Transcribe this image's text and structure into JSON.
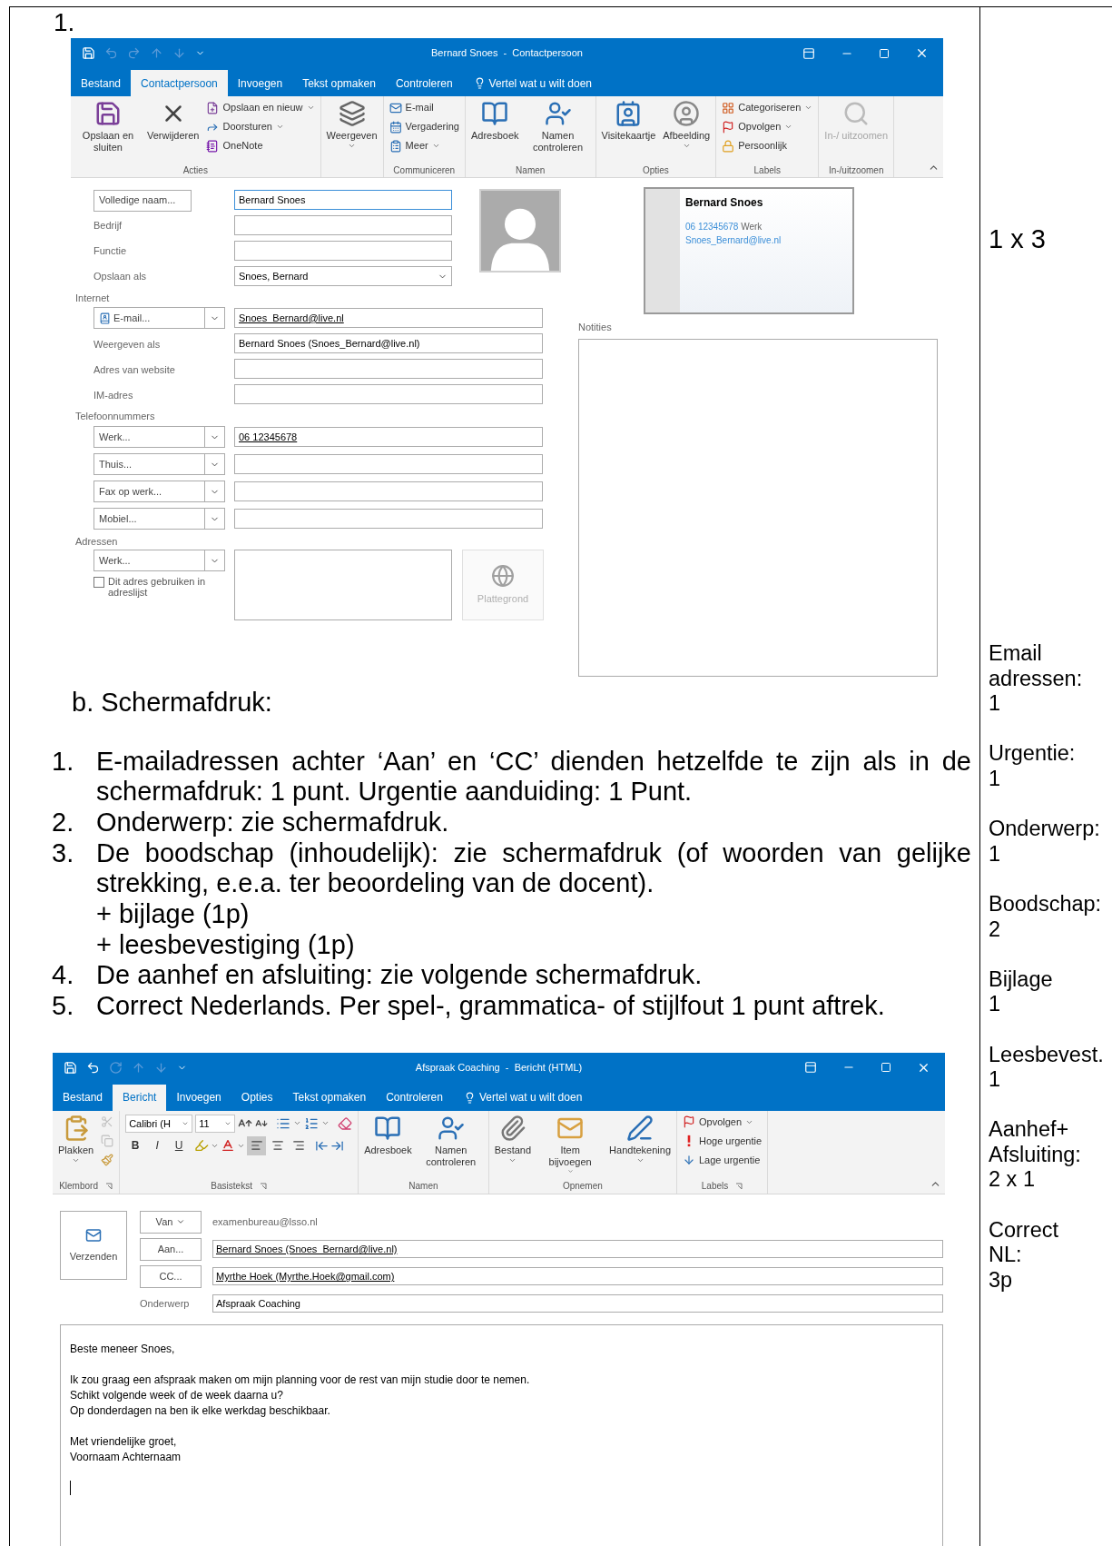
{
  "question_number": "1.",
  "contact_window": {
    "title": "Bernard Snoes  -  Contactpersoon",
    "quick_access": [
      {
        "disabled": false
      },
      {
        "disabled": true
      },
      {
        "disabled": true
      },
      {
        "disabled": true
      },
      {
        "disabled": true
      },
      {
        "disabled": false
      }
    ],
    "tabs": [
      {
        "label": "Bestand",
        "selected": false
      },
      {
        "label": "Contactpersoon",
        "selected": true
      },
      {
        "label": "Invoegen",
        "selected": false
      },
      {
        "label": "Tekst opmaken",
        "selected": false
      },
      {
        "label": "Controleren",
        "selected": false
      }
    ],
    "tell_me": "Vertel wat u wilt doen",
    "ribbon": [
      {
        "label": "Acties",
        "launcher": false,
        "kind": "buttons",
        "items": [
          {
            "kind": "large",
            "label": "Opslaan en sluiten",
            "dropdown": false,
            "disabled": false
          },
          {
            "kind": "large",
            "label": "Verwijderen",
            "dropdown": false,
            "disabled": false
          },
          {
            "kind": "small",
            "label": "Opslaan en nieuw",
            "dropdown": true,
            "disabled": false
          },
          {
            "kind": "small",
            "label": "Doorsturen",
            "dropdown": true,
            "disabled": false
          },
          {
            "kind": "small",
            "label": "OneNote",
            "dropdown": false,
            "disabled": false
          }
        ]
      },
      {
        "launcher": false,
        "kind": "buttons",
        "items": [
          {
            "kind": "large",
            "label": "Weergeven",
            "dropdown": true,
            "disabled": false
          }
        ]
      },
      {
        "label": "Communiceren",
        "launcher": false,
        "kind": "buttons",
        "items": [
          {
            "kind": "small",
            "label": "E-mail",
            "dropdown": false,
            "disabled": false
          },
          {
            "kind": "small",
            "label": "Vergadering",
            "dropdown": false,
            "disabled": false
          },
          {
            "kind": "small",
            "label": "Meer",
            "dropdown": true,
            "disabled": false
          }
        ]
      },
      {
        "label": "Namen",
        "launcher": false,
        "kind": "buttons",
        "items": [
          {
            "kind": "large",
            "label": "Adresboek",
            "dropdown": false,
            "disabled": false
          },
          {
            "kind": "large",
            "label": "Namen controleren",
            "dropdown": false,
            "disabled": false
          }
        ]
      },
      {
        "label": "Opties",
        "launcher": false,
        "kind": "buttons",
        "items": [
          {
            "kind": "large",
            "label": "Visitekaartje",
            "dropdown": false,
            "disabled": false
          },
          {
            "kind": "large",
            "label": "Afbeelding",
            "dropdown": true,
            "disabled": false
          }
        ]
      },
      {
        "label": "Labels",
        "launcher": false,
        "kind": "buttons",
        "items": [
          {
            "kind": "small",
            "label": "Categoriseren",
            "dropdown": true,
            "disabled": false
          },
          {
            "kind": "small",
            "label": "Opvolgen",
            "dropdown": true,
            "disabled": false
          },
          {
            "kind": "small",
            "label": "Persoonlijk",
            "dropdown": false,
            "disabled": false
          }
        ]
      },
      {
        "label": "In-/uitzoomen",
        "launcher": false,
        "kind": "buttons",
        "items": [
          {
            "kind": "large",
            "label": "In-/ uitzoomen",
            "dropdown": false,
            "disabled": true
          }
        ]
      }
    ]
  },
  "contact_form": {
    "full_name": {
      "button": "Volledige naam...",
      "value": "Bernard Snoes",
      "focused": true
    },
    "fields": [
      {
        "label": "Bedrijf",
        "dropdown": false
      },
      {
        "label": "Functie",
        "dropdown": false
      },
      {
        "label": "Opslaan als",
        "value": "Snoes, Bernard",
        "dropdown": true
      }
    ],
    "sections": [
      {
        "title": "Internet",
        "rows": [
          {
            "kind": "email_picker",
            "button": "E-mail...",
            "value": "Snoes_Bernard@live.nl",
            "link": true
          },
          {
            "kind": "labeled",
            "label": "Weergeven als",
            "value": "Bernard Snoes (Snoes_Bernard@live.nl)",
            "link": false
          },
          {
            "kind": "labeled",
            "label": "Adres van website"
          },
          {
            "kind": "labeled",
            "label": "IM-adres"
          }
        ]
      },
      {
        "title": "Telefoonnummers",
        "rows": [
          {
            "kind": "picker",
            "button": "Werk...",
            "value": "06 12345678",
            "link": true
          },
          {
            "kind": "picker",
            "button": "Thuis..."
          },
          {
            "kind": "picker",
            "button": "Fax op werk..."
          },
          {
            "kind": "picker",
            "button": "Mobiel..."
          }
        ]
      }
    ],
    "address": {
      "title": "Adressen",
      "button": "Werk...",
      "checkbox": {
        "label": "Dit adres gebruiken in adreslijst",
        "checked": false
      },
      "map_button": {
        "label": "Plattegrond",
        "disabled": true
      }
    },
    "business_card": {
      "name": "Bernard Snoes",
      "phone": "06 12345678",
      "phone_type": "Werk",
      "email": "Snoes_Bernard@live.nl"
    },
    "notes_label": "Notities"
  },
  "screenshot_caption": "b. Schermafdruk:",
  "criteria": [
    {
      "number": "1.",
      "text": "E-mailadressen achter ‘Aan’ en ‘CC’ dienden hetzelfde te zijn als in de schermafdruk: 1 punt. Urgentie aanduiding: 1 Punt."
    },
    {
      "number": "2.",
      "text": "Onderwerp: zie schermafdruk."
    },
    {
      "number": "3.",
      "text": "De boodschap (inhoudelijk): zie schermafdruk (of woorden van gelijke strekking, e.e.a. ter beoordeling van de docent).",
      "sub_lines": [
        "+ bijlage (1p)",
        "+ leesbevestiging (1p)"
      ]
    },
    {
      "number": "4.",
      "text": "De aanhef en afsluiting: zie volgende schermafdruk."
    },
    {
      "number": "5.",
      "text": "Correct Nederlands. Per spel-, grammatica- of stijlfout 1 punt aftrek."
    }
  ],
  "message_window": {
    "title": "Afspraak Coaching  -  Bericht (HTML)",
    "quick_access": [
      {
        "disabled": false
      },
      {
        "disabled": false
      },
      {
        "disabled": true
      },
      {
        "disabled": true
      },
      {
        "disabled": true
      },
      {
        "disabled": false
      }
    ],
    "tabs": [
      {
        "label": "Bestand",
        "selected": false
      },
      {
        "label": "Bericht",
        "selected": true
      },
      {
        "label": "Invoegen",
        "selected": false
      },
      {
        "label": "Opties",
        "selected": false
      },
      {
        "label": "Tekst opmaken",
        "selected": false
      },
      {
        "label": "Controleren",
        "selected": false
      }
    ],
    "tell_me": "Vertel wat u wilt doen",
    "ribbon": [
      {
        "label": "Klembord",
        "launcher": true,
        "kind": "buttons",
        "items": [
          {
            "kind": "large",
            "label": "Plakken",
            "dropdown": true,
            "disabled": false
          },
          {
            "kind": "small",
            "dropdown": false,
            "disabled": true
          },
          {
            "kind": "small",
            "dropdown": false,
            "disabled": true
          },
          {
            "kind": "small",
            "dropdown": false,
            "disabled": false
          }
        ]
      },
      {
        "label": "Basistekst",
        "launcher": true,
        "kind": "text_format",
        "font_name": "Calibri (H",
        "font_size": "11",
        "style_buttons": [
          "B",
          "I",
          "U"
        ],
        "alignments": [
          {
            "selected": true
          },
          {
            "selected": false
          },
          {
            "selected": false
          }
        ]
      },
      {
        "label": "Namen",
        "launcher": false,
        "kind": "buttons",
        "items": [
          {
            "kind": "large",
            "label": "Adresboek",
            "dropdown": false,
            "disabled": false
          },
          {
            "kind": "large",
            "label": "Namen controleren",
            "dropdown": false,
            "disabled": false
          }
        ]
      },
      {
        "label": "Opnemen",
        "launcher": false,
        "kind": "buttons",
        "items": [
          {
            "kind": "large",
            "label": "Bestand",
            "dropdown": true,
            "disabled": false
          },
          {
            "kind": "large",
            "label": "Item bijvoegen",
            "dropdown": true,
            "disabled": false
          },
          {
            "kind": "large",
            "label": "Handtekening",
            "dropdown": true,
            "disabled": false
          }
        ]
      },
      {
        "label": "Labels",
        "launcher": true,
        "kind": "buttons",
        "items": [
          {
            "kind": "small",
            "label": "Opvolgen",
            "dropdown": true,
            "disabled": false
          },
          {
            "kind": "small",
            "label": "Hoge urgentie",
            "dropdown": false,
            "disabled": false
          },
          {
            "kind": "small",
            "label": "Lage urgentie",
            "dropdown": false,
            "disabled": false
          }
        ]
      }
    ]
  },
  "compose": {
    "send_button": "Verzenden",
    "from_button": "Van",
    "from_value": "examenbureau@lsso.nl",
    "recipients": [
      {
        "button": "Aan...",
        "value": "Bernard Snoes (Snoes_Bernard@live.nl)"
      },
      {
        "button": "CC...",
        "value": "Myrthe Hoek (Myrthe.Hoek@gmail.com)"
      }
    ],
    "subject_label": "Onderwerp",
    "subject": "Afspraak Coaching",
    "body": [
      [
        "Beste meneer Snoes,"
      ],
      [
        "Ik zou graag een afspraak maken om mijn planning voor de rest van mijn studie door te nemen.",
        "Schikt volgende week of de week daarna u?",
        "Op donderdagen na ben ik elke werkdag beschikbaar."
      ],
      [
        "Met vriendelijke groet,",
        "Voornaam Achternaam"
      ]
    ]
  },
  "points": "1 x 3",
  "scores": [
    {
      "lines": [
        "Email",
        "adressen:"
      ],
      "value": "1"
    },
    {
      "lines": [
        "Urgentie:"
      ],
      "value": "1"
    },
    {
      "lines": [
        "Onderwerp:"
      ],
      "value": "1"
    },
    {
      "lines": [
        "Boodschap:"
      ],
      "value": "2"
    },
    {
      "lines": [
        "Bijlage"
      ],
      "value": "1"
    },
    {
      "lines": [
        "Leesbevest."
      ],
      "value": "1"
    },
    {
      "lines": [
        "Aanhef+",
        "Afsluiting:"
      ],
      "value": "2 x 1"
    },
    {
      "lines": [
        "Correct",
        "NL:"
      ],
      "value": "3p"
    }
  ]
}
